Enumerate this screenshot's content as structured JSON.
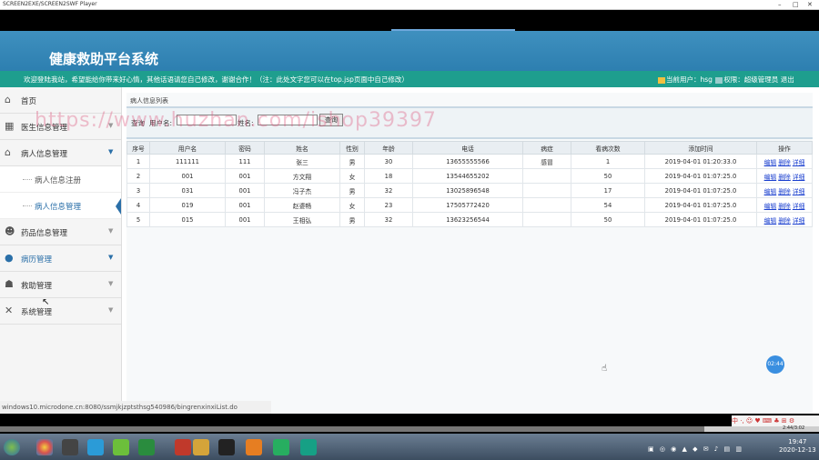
{
  "window": {
    "title": "SCREEN2EXE/SCREEN2SWF Player"
  },
  "app": {
    "title": "健康救助平台系统",
    "welcome": "欢迎登陆我站，希望能给你带来好心情，其他话语请您自己修改，谢谢合作！（注：此处文字您可以在top.jsp页面中自己修改）",
    "current_user_label": "当前用户：hsg",
    "role_label": "权限：超级管理员",
    "logout_label": "退出"
  },
  "sidebar": {
    "items": [
      {
        "label": "首页",
        "icon": "home-icon"
      },
      {
        "label": "医生信息管理",
        "icon": "grid-icon"
      },
      {
        "label": "病人信息管理",
        "icon": "house-icon"
      },
      {
        "label": "药品信息管理",
        "icon": "users-icon"
      },
      {
        "label": "病历管理",
        "icon": "user-icon"
      },
      {
        "label": "救助管理",
        "icon": "user-plus-icon"
      },
      {
        "label": "系统管理",
        "icon": "tools-icon"
      }
    ],
    "subitems": [
      {
        "label": "病人信息注册"
      },
      {
        "label": "病人信息管理"
      }
    ]
  },
  "content": {
    "crumb": "病人信息列表",
    "search": {
      "prefix": "查询",
      "username_label": "用户名:",
      "name_label": "姓名:",
      "username_value": "",
      "name_value": "",
      "button": "查询"
    },
    "table": {
      "headers": [
        "序号",
        "用户名",
        "密码",
        "姓名",
        "性别",
        "年龄",
        "电话",
        "病症",
        "看病次数",
        "添加时间",
        "操作"
      ],
      "actions": [
        "编辑",
        "删除",
        "详细"
      ],
      "rows": [
        [
          "1",
          "111111",
          "111",
          "张三",
          "男",
          "30",
          "13655555566",
          "感冒",
          "1",
          "2019-04-01 01:20:33.0"
        ],
        [
          "2",
          "001",
          "001",
          "方文翔",
          "女",
          "18",
          "13544655202",
          "",
          "50",
          "2019-04-01 01:07:25.0"
        ],
        [
          "3",
          "031",
          "001",
          "冯子杰",
          "男",
          "32",
          "13025896548",
          "",
          "17",
          "2019-04-01 01:07:25.0"
        ],
        [
          "4",
          "019",
          "001",
          "赵婆畅",
          "女",
          "23",
          "17505772420",
          "",
          "54",
          "2019-04-01 01:07:25.0"
        ],
        [
          "5",
          "015",
          "001",
          "王相弘",
          "男",
          "32",
          "13623256544",
          "",
          "50",
          "2019-04-01 01:07:25.0"
        ]
      ]
    }
  },
  "statusbar": {
    "url": "windows10.microdone.cn:8080/ssmjkjzptsthsg540986/bingrenxinxiList.do"
  },
  "watermark": "https://www.huzhan.com/ishop39397",
  "player": {
    "timer": "02:44",
    "ime": "中 ·, ☺ ♥ ⌨ ♣ ⊞ ⚙",
    "time": "2:44/3:02",
    "progress": 0.86
  },
  "taskbar": {
    "time": "19:47",
    "date": "2020-12-13"
  }
}
